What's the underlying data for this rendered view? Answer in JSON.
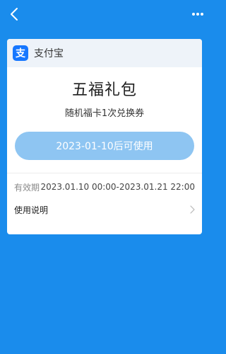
{
  "header": {
    "back_icon": "chevron-left-icon",
    "more_icon": "more-dots-icon"
  },
  "card": {
    "brand_name": "支付宝",
    "brand_logo_text": "支",
    "brand_color": "#1677ff",
    "title": "五福礼包",
    "subtitle": "随机福卡1次兑换券",
    "button_label": "2023-01-10后可使用",
    "validity_label": "有效期",
    "validity_value": "2023.01.10 00:00-2023.01.21 22:00",
    "instructions_label": "使用说明"
  },
  "colors": {
    "background": "#1a8cec",
    "button_disabled": "#8ec5f2"
  }
}
